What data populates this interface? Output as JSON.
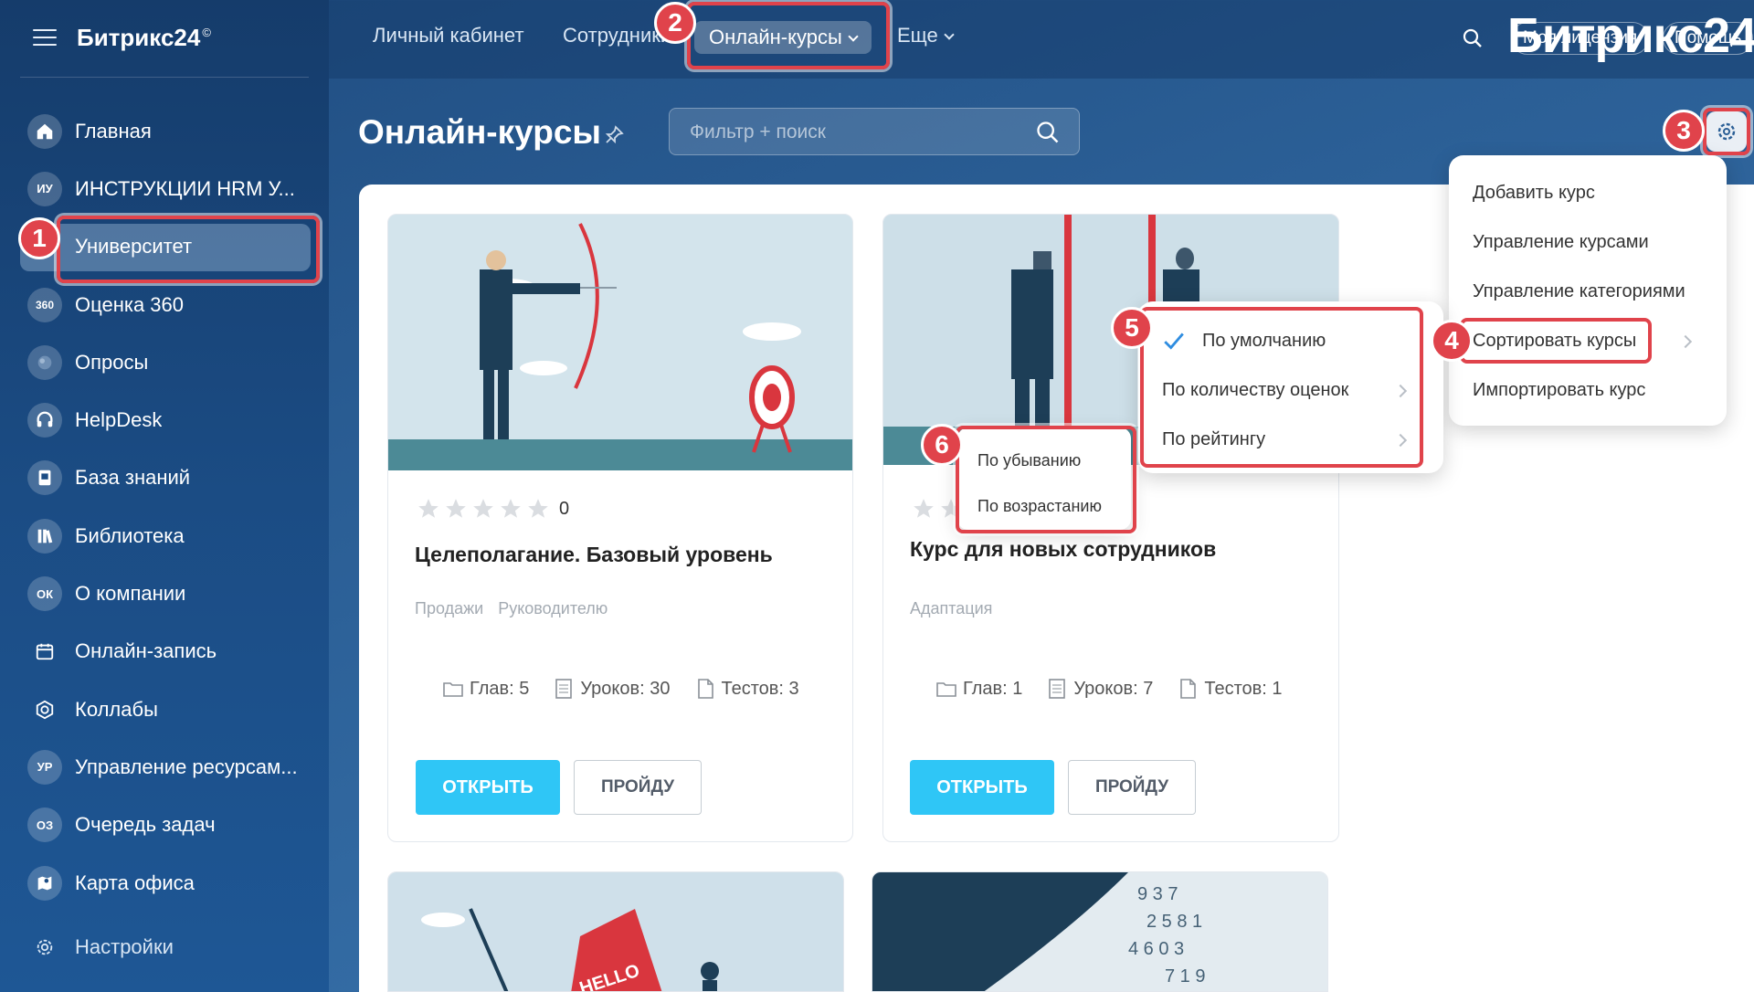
{
  "sidebar": {
    "logo": "Битрикс24",
    "logo_mark": "©",
    "items": [
      {
        "label": "Главная",
        "icon": "home-icon"
      },
      {
        "label": "ИНСТРУКЦИИ HRM У...",
        "icon": "initials",
        "abbr": "ИУ"
      },
      {
        "label": "Университет",
        "icon": "university-icon",
        "active": true
      },
      {
        "label": "Оценка 360",
        "icon": "rating-360-icon",
        "abbr": "360"
      },
      {
        "label": "Опросы",
        "icon": "polls-icon"
      },
      {
        "label": "HelpDesk",
        "icon": "headset-icon"
      },
      {
        "label": "База знаний",
        "icon": "knowledge-base-icon"
      },
      {
        "label": "Библиотека",
        "icon": "library-icon"
      },
      {
        "label": "О компании",
        "icon": "initials",
        "abbr": "ОК"
      },
      {
        "label": "Онлайн-запись",
        "icon": "calendar-icon"
      },
      {
        "label": "Коллабы",
        "icon": "collab-icon"
      },
      {
        "label": "Управление ресурсам...",
        "icon": "initials",
        "abbr": "УР"
      },
      {
        "label": "Очередь задач",
        "icon": "initials",
        "abbr": "ОЗ"
      },
      {
        "label": "Карта офиса",
        "icon": "map-icon"
      }
    ],
    "settings_label": "Настройки"
  },
  "topbar": {
    "nav": [
      "Личный кабинет",
      "Сотрудники",
      "Онлайн-курсы",
      "Еще"
    ],
    "brand": "Битрикс24",
    "license_button": "Моя лицензия",
    "help_button": "Помощь"
  },
  "page": {
    "title": "Онлайн-курсы",
    "filter_placeholder": "Фильтр + поиск"
  },
  "courses": [
    {
      "rating_count": "0",
      "title": "Целеполагание. Базовый уровень",
      "tags": [
        "Продажи",
        "Руководителю"
      ],
      "chapters": "Глав: 5",
      "lessons": "Уроков: 30",
      "tests": "Тестов: 3",
      "open_label": "ОТКРЫТЬ",
      "pass_label": "ПРОЙДУ"
    },
    {
      "rating_count": "",
      "title": "Курс для новых сотрудников",
      "tags": [
        "Адаптация"
      ],
      "chapters": "Глав: 1",
      "lessons": "Уроков: 7",
      "tests": "Тестов: 1",
      "open_label": "ОТКРЫТЬ",
      "pass_label": "ПРОЙДУ"
    }
  ],
  "settings_menu": {
    "items": [
      "Добавить курс",
      "Управление курсами",
      "Управление категориями",
      "Сортировать курсы",
      "Импортировать курс"
    ]
  },
  "sort_menu": {
    "items": [
      "По умолчанию",
      "По количеству оценок",
      "По рейтингу"
    ]
  },
  "order_menu": {
    "items": [
      "По убыванию",
      "По возрастанию"
    ]
  },
  "img_text": "HELLO",
  "callouts": [
    "1",
    "2",
    "3",
    "4",
    "5",
    "6"
  ],
  "colors": {
    "accent_red": "#e0434b",
    "open_button": "#2fc6f6",
    "sidebar_bg": "#1b4c84"
  }
}
